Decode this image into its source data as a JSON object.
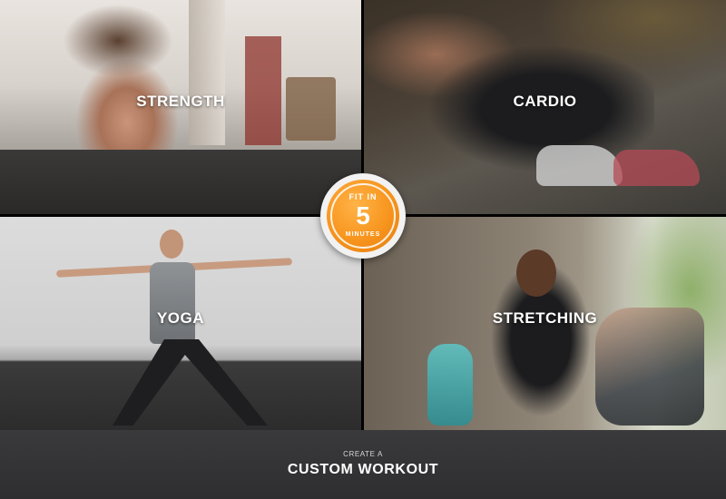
{
  "tiles": [
    {
      "label": "STRENGTH"
    },
    {
      "label": "CARDIO"
    },
    {
      "label": "YOGA"
    },
    {
      "label": "STRETCHING"
    }
  ],
  "badge": {
    "top_text": "FIT IN",
    "number": "5",
    "bottom_text": "MINUTES",
    "color": "#f7941d"
  },
  "footer": {
    "small_text": "CREATE A",
    "main_text": "CUSTOM WORKOUT"
  }
}
